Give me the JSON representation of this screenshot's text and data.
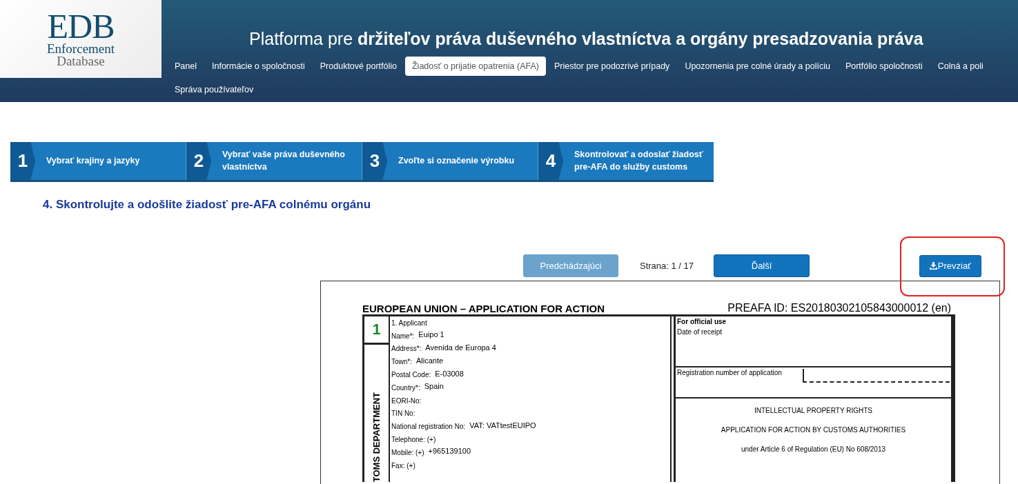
{
  "logo": {
    "mark": "EDB",
    "line1": "Enforcement",
    "line2": "Database"
  },
  "header": {
    "title_plain": "Platforma pre ",
    "title_bold": "držiteľov práva duševného vlastníctva a orgány presadzovania práva"
  },
  "nav_rows": [
    [
      {
        "label": "Panel",
        "selected": false
      },
      {
        "label": "Informácie o spoločnosti",
        "selected": false
      },
      {
        "label": "Produktové portfólio",
        "selected": false
      },
      {
        "label": "Žiadosť o prijatie opatrenia (AFA)",
        "selected": true
      },
      {
        "label": "Priestor pre podozrivé prípady",
        "selected": false
      },
      {
        "label": "Upozornenia pre colné úrady a políciu",
        "selected": false
      },
      {
        "label": "Portfólio spoločnosti",
        "selected": false
      },
      {
        "label": "Colná a poli",
        "selected": false
      }
    ],
    [
      {
        "label": "Správa používateľov",
        "selected": false
      }
    ]
  ],
  "steps": [
    {
      "number": "1",
      "label": "Vybrať krajiny a jazyky"
    },
    {
      "number": "2",
      "label": "Vybrať vaše práva duševného vlastníctva"
    },
    {
      "number": "3",
      "label": "Zvoľte si označenie výrobku"
    },
    {
      "number": "4",
      "label": "Skontrolovať a odoslať žiadosť pre-AFA do služby customs"
    }
  ],
  "section_heading": "4. Skontrolujte a odošlite žiadosť pre-AFA colnému orgánu",
  "pager": {
    "previous": {
      "label": "Predchádzajúci",
      "disabled": true
    },
    "page_text": "Strana: 1 / 17",
    "next": {
      "label": "Ďalší",
      "disabled": false
    },
    "download": {
      "label": "Prevziať",
      "highlighted": true
    }
  },
  "document": {
    "title": "EUROPEAN UNION – APPLICATION FOR ACTION",
    "id_text": "PREAFA ID: ES20180302105843000012 (en)",
    "box_number": "1",
    "side_label": "TOMS DEPARTMENT",
    "fields": [
      {
        "label": "1. Applicant"
      },
      {
        "label": "Name*:",
        "value": "Euipo 1"
      },
      {
        "label": "Address*:",
        "value": "Avenida de Europa 4"
      },
      {
        "label": "Town*:",
        "value": "Alicante"
      },
      {
        "label": "Postal Code:",
        "value": "E-03008"
      },
      {
        "label": "Country*:",
        "value": "Spain"
      },
      {
        "label": "EORI-No:"
      },
      {
        "label": "TIN No:"
      },
      {
        "label": "National registration No:",
        "value": "VAT: VATtestEUIPO"
      },
      {
        "label": "Telephone: (+)"
      },
      {
        "label": "Mobile: (+)",
        "value": "+965139100"
      },
      {
        "label": "Fax: (+)"
      }
    ],
    "official_heading": "For official use",
    "date_label": "Date of receipt",
    "registration_label": "Registration number of application",
    "notice_lines": [
      "INTELLECTUAL PROPERTY RIGHTS",
      "APPLICATION FOR ACTION BY CUSTOMS AUTHORITIES",
      "under Article 6 of Regulation (EU) No 608/2013"
    ]
  }
}
